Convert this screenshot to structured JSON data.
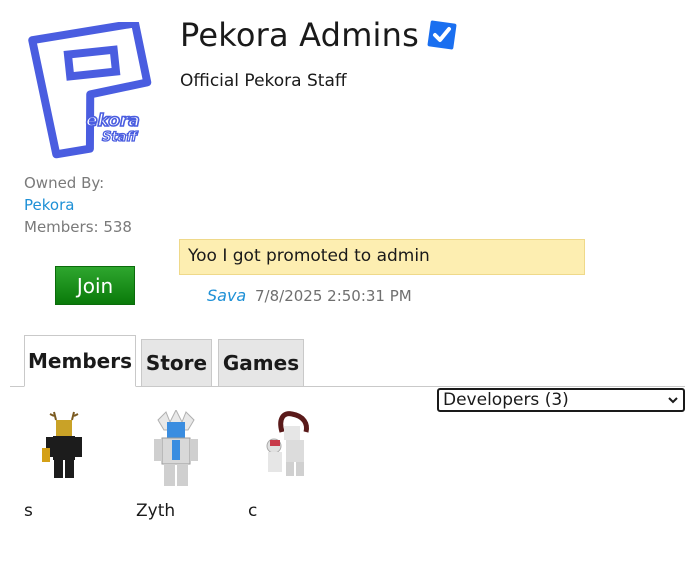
{
  "group": {
    "name": "Pekora Admins",
    "description": "Official Pekora Staff",
    "owned_by_label": "Owned By:",
    "owner": "Pekora",
    "members_label": "Members: 538",
    "logo_text_top": "ekora",
    "logo_text_bottom": "Staff",
    "verified_icon": "verified-check-icon"
  },
  "join_button": "Join",
  "shout": {
    "message": "Yoo I got promoted to admin",
    "author": "Sava",
    "timestamp": "7/8/2025 2:50:31 PM"
  },
  "tabs": [
    {
      "label": "Members",
      "active": true
    },
    {
      "label": "Store",
      "active": false
    },
    {
      "label": "Games",
      "active": false
    }
  ],
  "role_filter": {
    "selected": "Developers (3)"
  },
  "members": [
    {
      "name": "s"
    },
    {
      "name": "Zyth"
    },
    {
      "name": "c"
    }
  ],
  "colors": {
    "accent_blue": "#1e90d6",
    "logo_blue": "#4a5de0",
    "join_green": "#1a8f1a",
    "shout_bg": "#fdeeb1",
    "verified_blue": "#1a6ff0"
  }
}
